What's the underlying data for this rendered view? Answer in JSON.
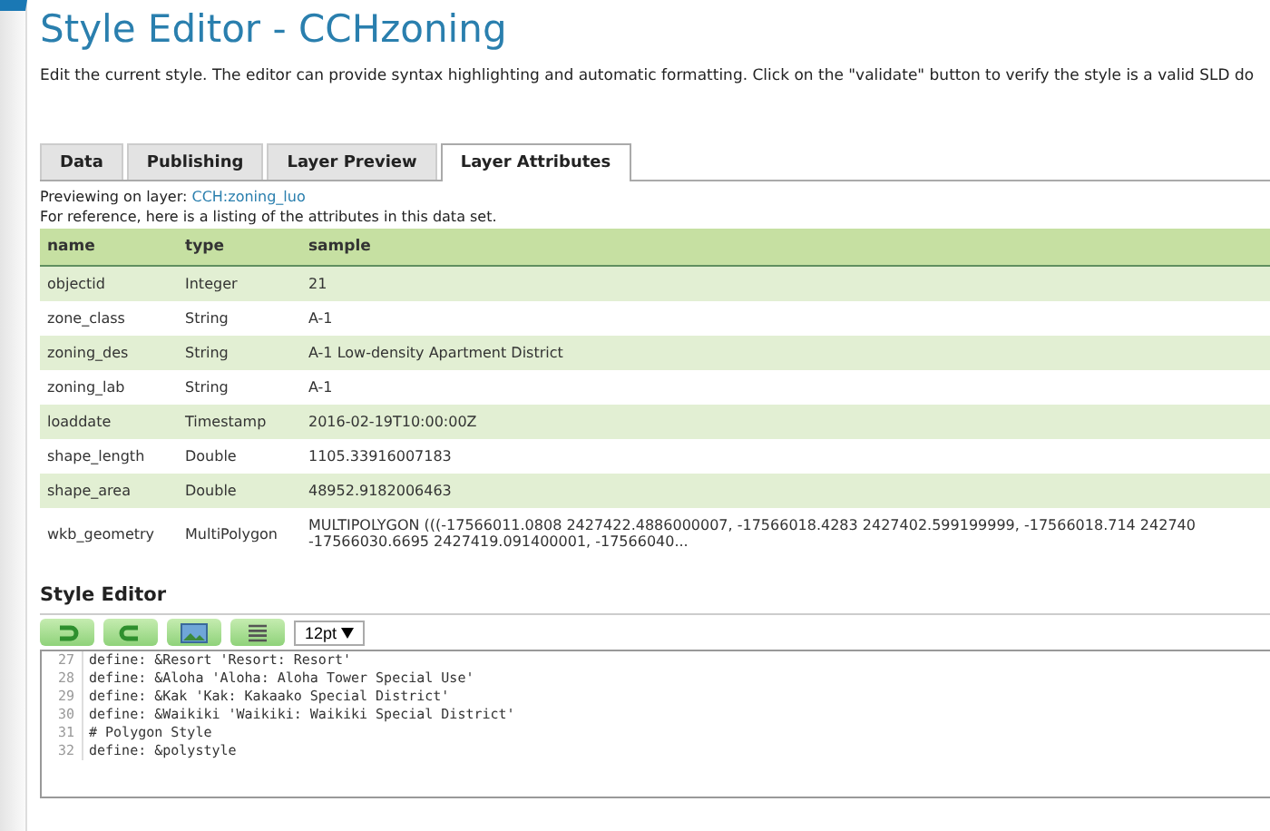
{
  "title": "Style Editor - CCHzoning",
  "description": "Edit the current style. The editor can provide syntax highlighting and automatic formatting. Click on the \"validate\" button to verify the style is a valid SLD do",
  "tabs": [
    {
      "label": "Data",
      "selected": false
    },
    {
      "label": "Publishing",
      "selected": false
    },
    {
      "label": "Layer Preview",
      "selected": false
    },
    {
      "label": "Layer Attributes",
      "selected": true
    }
  ],
  "preview": {
    "label": "Previewing on layer:",
    "layer_link": "CCH:zoning_luo"
  },
  "reference_note": "For reference, here is a listing of the attributes in this data set.",
  "table": {
    "columns": [
      "name",
      "type",
      "sample"
    ],
    "rows": [
      [
        "objectid",
        "Integer",
        "21"
      ],
      [
        "zone_class",
        "String",
        "A-1"
      ],
      [
        "zoning_des",
        "String",
        "A-1 Low-density Apartment District"
      ],
      [
        "zoning_lab",
        "String",
        "A-1"
      ],
      [
        "loaddate",
        "Timestamp",
        "2016-02-19T10:00:00Z"
      ],
      [
        "shape_length",
        "Double",
        "1105.33916007183"
      ],
      [
        "shape_area",
        "Double",
        "48952.9182006463"
      ],
      [
        "wkb_geometry",
        "MultiPolygon",
        "MULTIPOLYGON (((-17566011.0808 2427422.4886000007, -17566018.4283 2427402.599199999, -17566018.714 242740 -17566030.6695 2427419.091400001, -17566040..."
      ]
    ]
  },
  "editor": {
    "heading": "Style Editor",
    "font_size": "12pt",
    "toolbar": [
      {
        "kind": "undo"
      },
      {
        "kind": "redo"
      },
      {
        "kind": "image"
      },
      {
        "kind": "format"
      }
    ],
    "lines": [
      {
        "number": "27",
        "code": "define: &Resort 'Resort: Resort'"
      },
      {
        "number": "28",
        "code": "define: &Aloha 'Aloha: Aloha Tower Special Use'"
      },
      {
        "number": "29",
        "code": "define: &Kak 'Kak: Kakaako Special District'"
      },
      {
        "number": "30",
        "code": "define: &Waikiki 'Waikiki: Waikiki Special District'"
      },
      {
        "number": "31",
        "code": "# Polygon Style"
      },
      {
        "number": "32",
        "code": "define: &polystyle"
      }
    ]
  }
}
